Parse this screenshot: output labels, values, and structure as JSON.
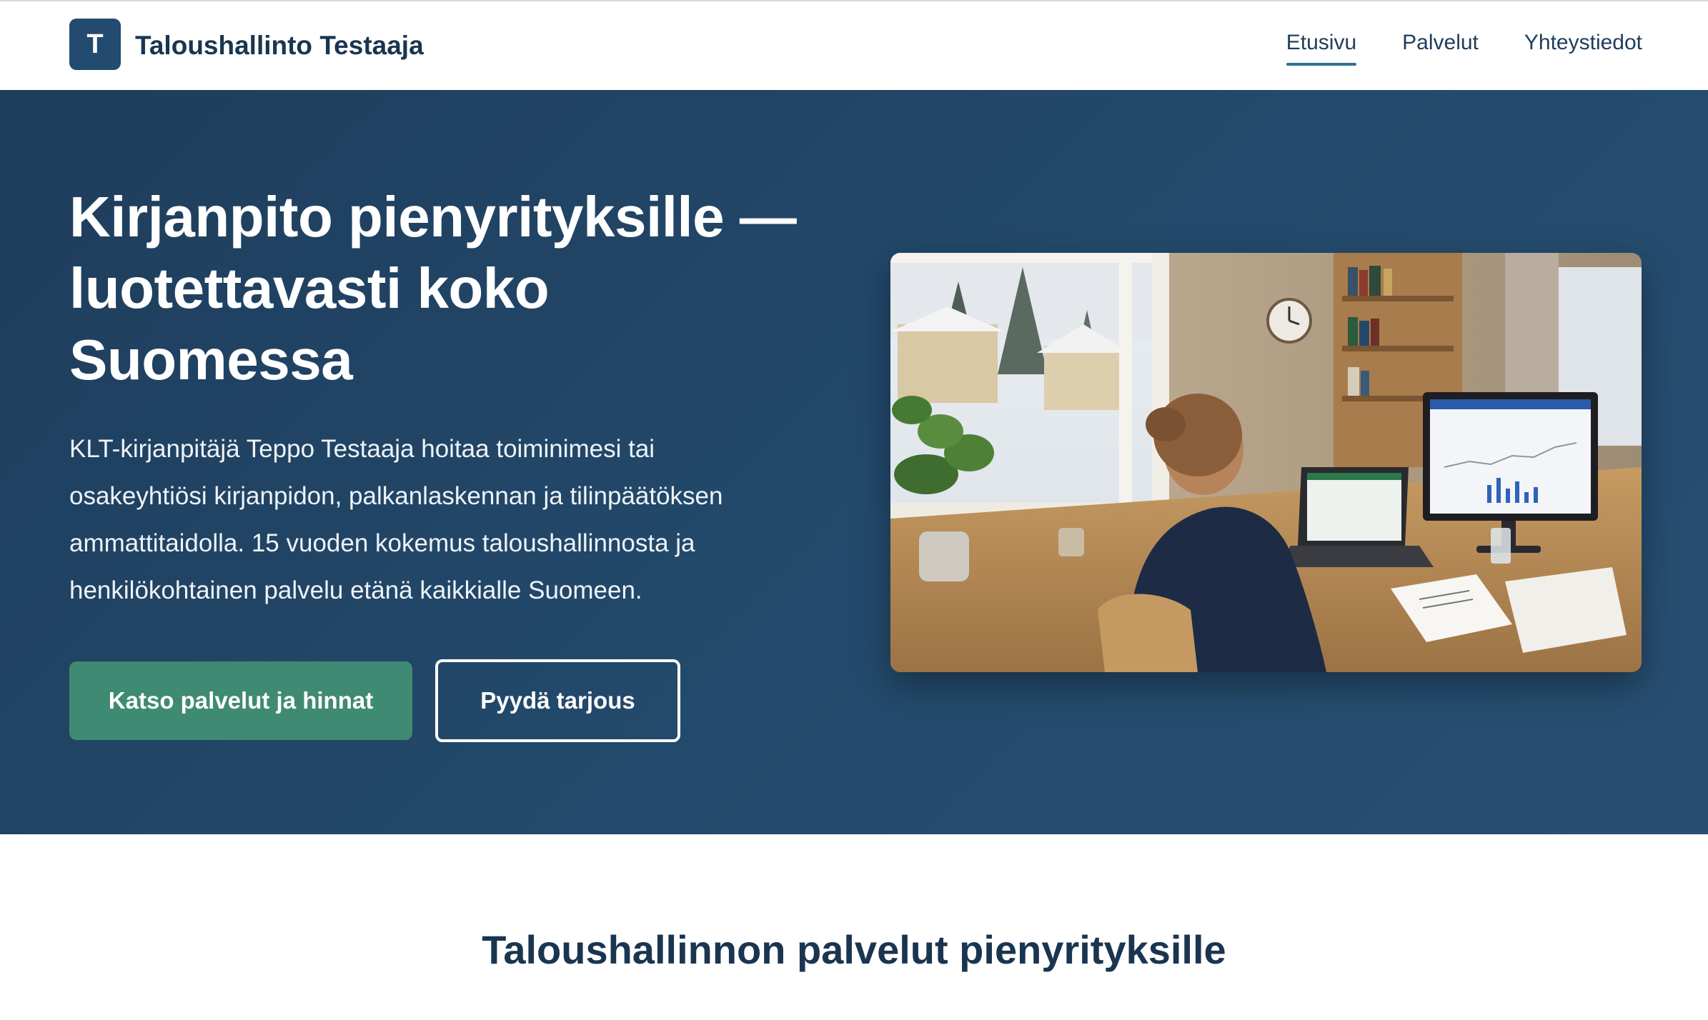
{
  "header": {
    "logo_letter": "T",
    "brand_name": "Taloushallinto Testaaja",
    "nav": [
      {
        "label": "Etusivu",
        "active": true
      },
      {
        "label": "Palvelut",
        "active": false
      },
      {
        "label": "Yhteystiedot",
        "active": false
      }
    ]
  },
  "hero": {
    "title": "Kirjanpito pienyrityksille — luotettavasti koko Suomessa",
    "text": "KLT-kirjanpitäjä Teppo Testaaja hoitaa toiminimesi tai osakeyhtiösi kirjanpidon, palkanlaskennan ja tilinpäätöksen ammattitaidolla. 15 vuoden kokemus taloushallinnosta ja henkilökohtainen palvelu etänä kaikkialle Suomeen.",
    "primary_button": "Katso palvelut ja hinnat",
    "secondary_button": "Pyydä tarjous"
  },
  "services": {
    "title": "Taloushallinnon palvelut pienyrityksille"
  },
  "colors": {
    "brand_dark": "#1f3d5c",
    "accent_green": "#3f8a72",
    "nav_underline": "#2f6f8f"
  }
}
